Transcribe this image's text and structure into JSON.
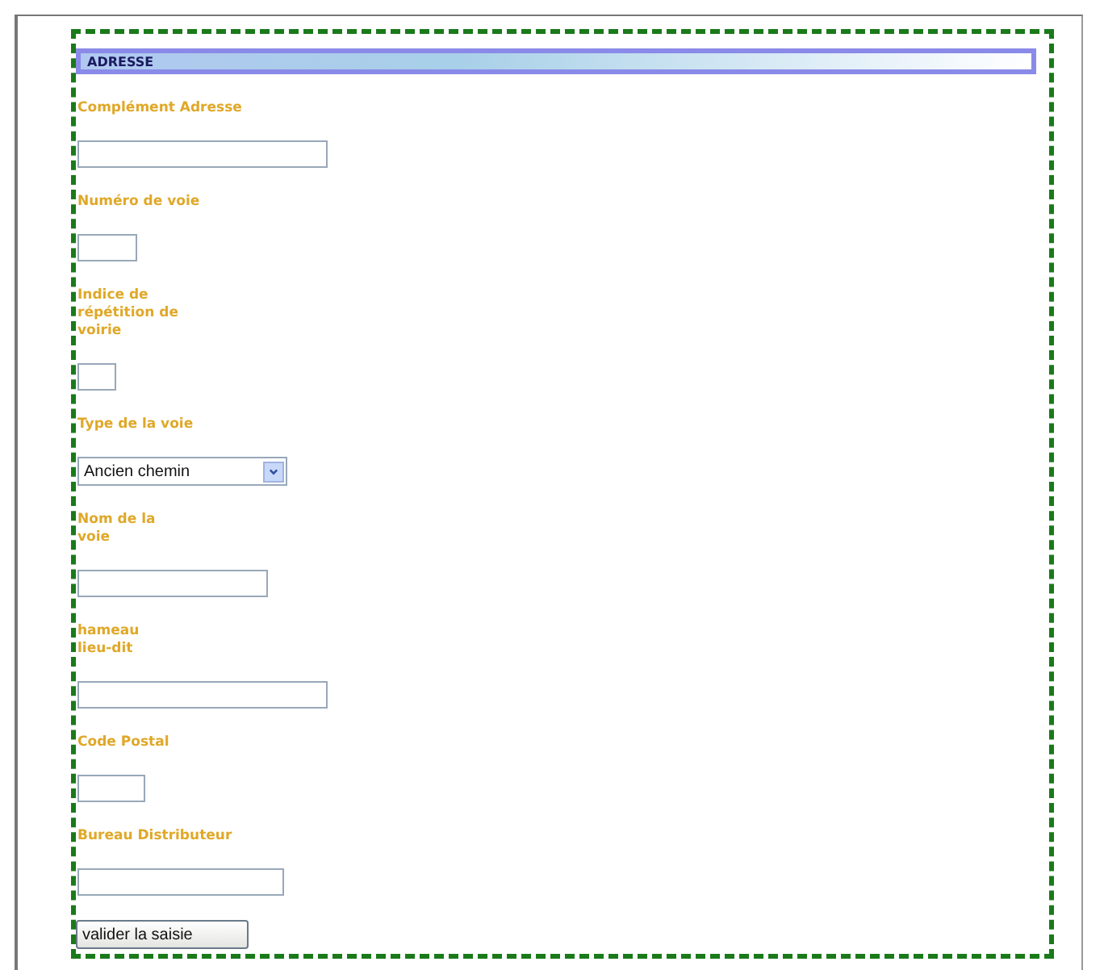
{
  "section": {
    "title": "ADRESSE"
  },
  "fields": [
    {
      "kind": "text",
      "label": "Complément Adresse"
    },
    {
      "kind": "text",
      "label": "Numéro de voie"
    },
    {
      "kind": "text",
      "label": "Indice de\nrépétition de\nvoirie"
    },
    {
      "kind": "select",
      "label": "Type de la voie",
      "value": "Ancien chemin"
    },
    {
      "kind": "text",
      "label": "Nom de la\nvoie"
    },
    {
      "kind": "text",
      "label": "hameau\nlieu-dit"
    },
    {
      "kind": "text",
      "label": "Code Postal"
    },
    {
      "kind": "text",
      "label": "Bureau Distributeur"
    }
  ],
  "submit": {
    "label": "valider la saisie"
  }
}
